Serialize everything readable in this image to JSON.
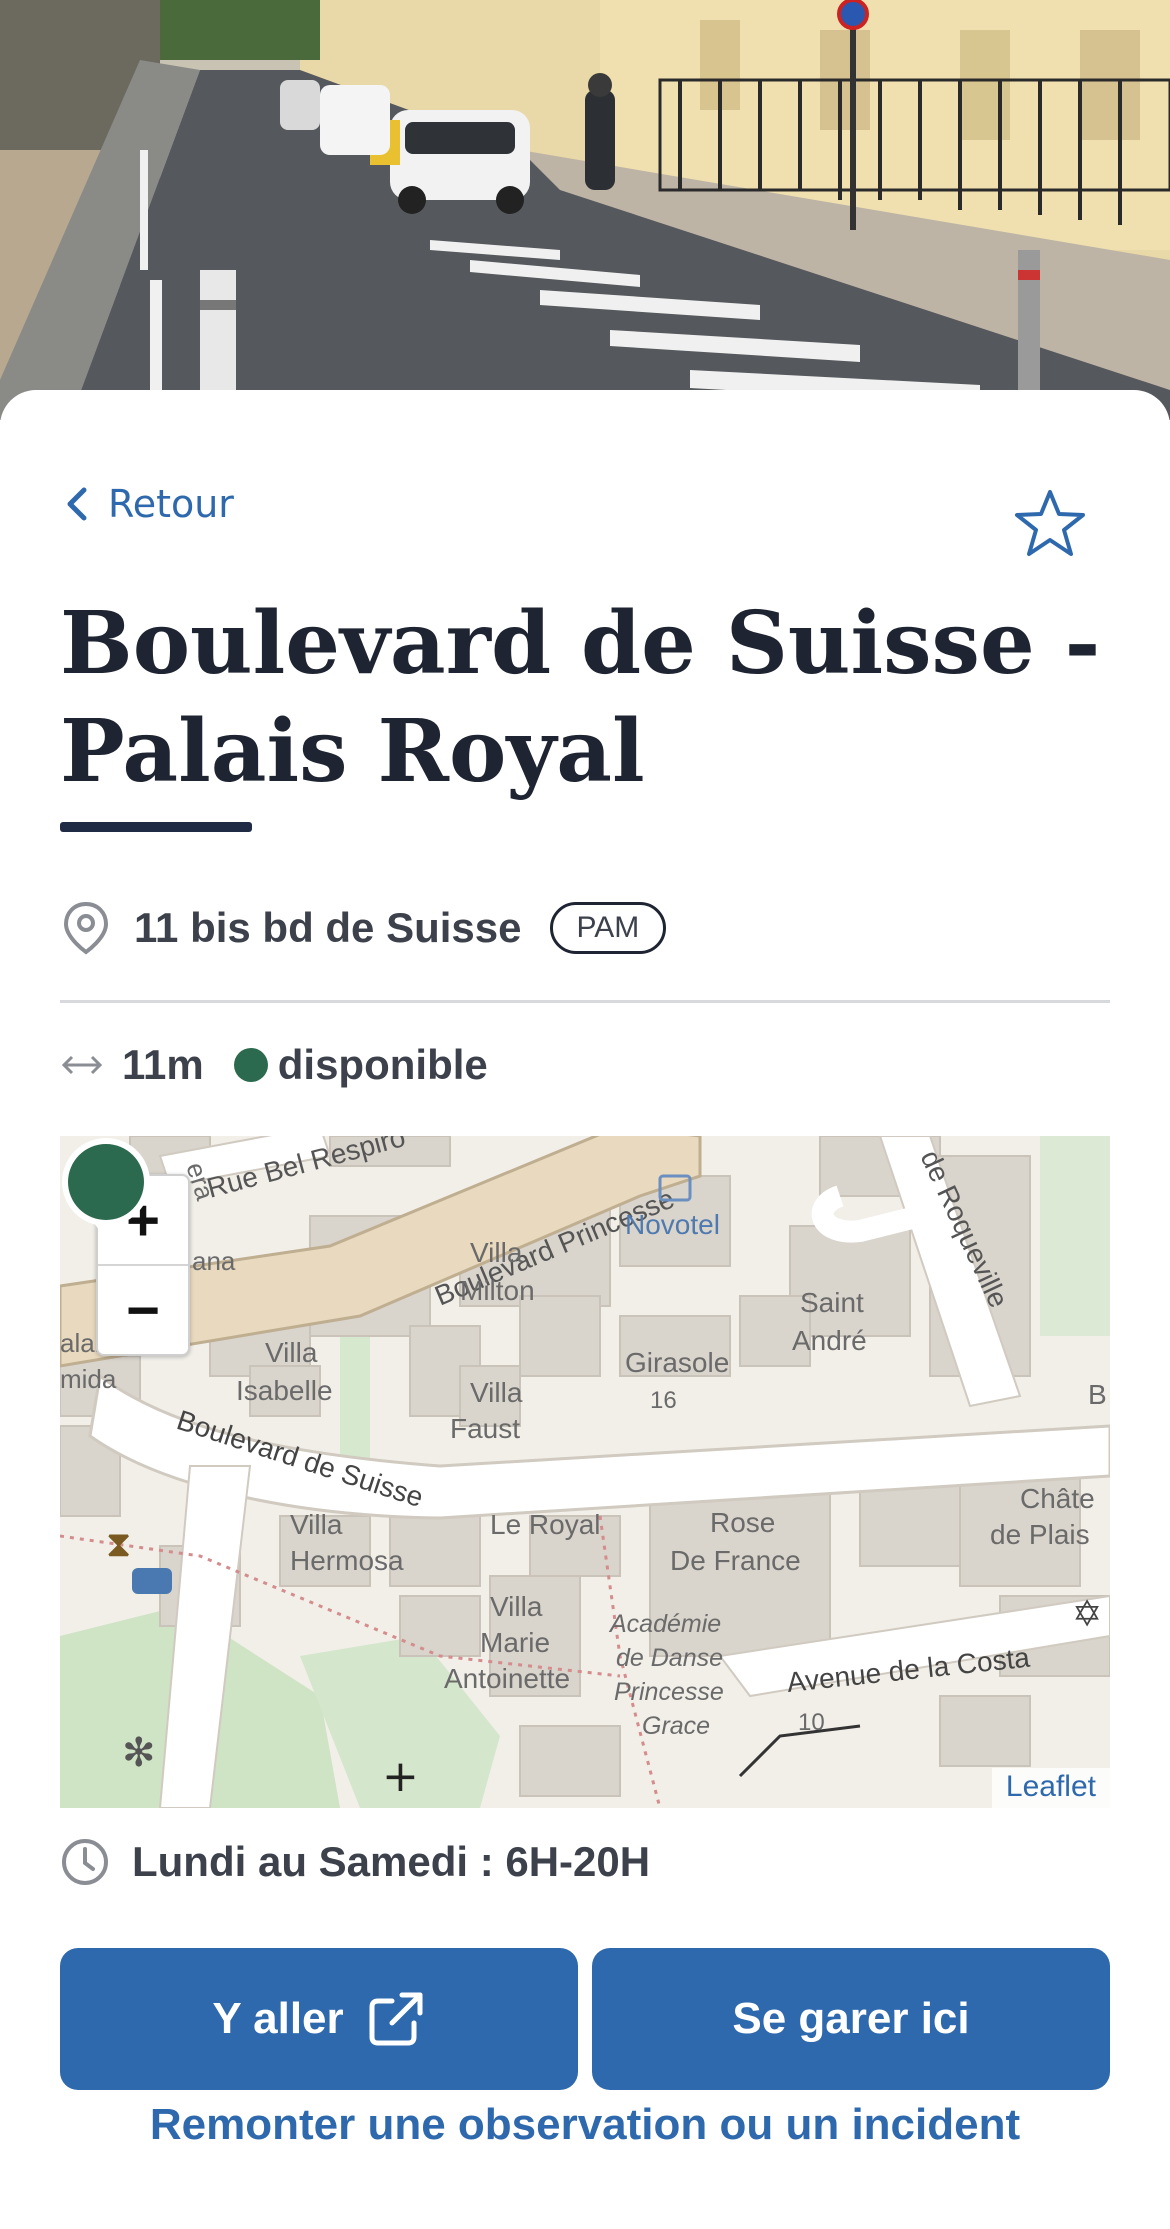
{
  "nav": {
    "back_label": "Retour"
  },
  "place": {
    "title": "Boulevard de Suisse - Palais Royal",
    "address": "11 bis bd de Suisse",
    "badge": "PAM",
    "distance": "11m",
    "status": "disponible",
    "status_color": "#2c6a4f",
    "hours": "Lundi au Samedi : 6H-20H"
  },
  "map": {
    "zoom_in": "+",
    "zoom_out": "−",
    "attribution": "Leaflet",
    "labels": {
      "rue_bel": "Rue Bel Respiro",
      "bd_princesse": "Boulevard Princesse",
      "roqueville": "de Roqueville",
      "novotel": "Novotel",
      "villa_milton_1": "Villa",
      "villa_milton_2": "Milton",
      "saint_andre_1": "Saint",
      "saint_andre_2": "André",
      "girasole": "Girasole",
      "num16": "16",
      "villa_isabelle_1": "Villa",
      "villa_isabelle_2": "Isabelle",
      "villa_faust_1": "Villa",
      "villa_faust_2": "Faust",
      "bd_suisse": "Boulevard de Suisse",
      "villa_hermosa_1": "Villa",
      "villa_hermosa_2": "Hermosa",
      "le_royal": "Le Royal",
      "rose_1": "Rose",
      "rose_2": "De France",
      "chateau_1": "Châte",
      "chateau_2": "de Plais",
      "villa_marie_1": "Villa",
      "villa_marie_2": "Marie",
      "villa_marie_3": "Antoinette",
      "academie_1": "Académie",
      "academie_2": "de Danse",
      "academie_3": "Princesse",
      "academie_4": "Grace",
      "av_costa": "Avenue de la Costa",
      "num10": "10",
      "edge_era": "era",
      "edge_ana": "ana",
      "edge_alais": "alais",
      "edge_mida": "mida",
      "edge_b": "B"
    }
  },
  "actions": {
    "go_label": "Y aller",
    "park_label": "Se garer ici",
    "report_label": "Remonter une observation ou un incident"
  },
  "colors": {
    "primary": "#2f69ad",
    "title": "#1e2431",
    "text": "#3c414b"
  }
}
